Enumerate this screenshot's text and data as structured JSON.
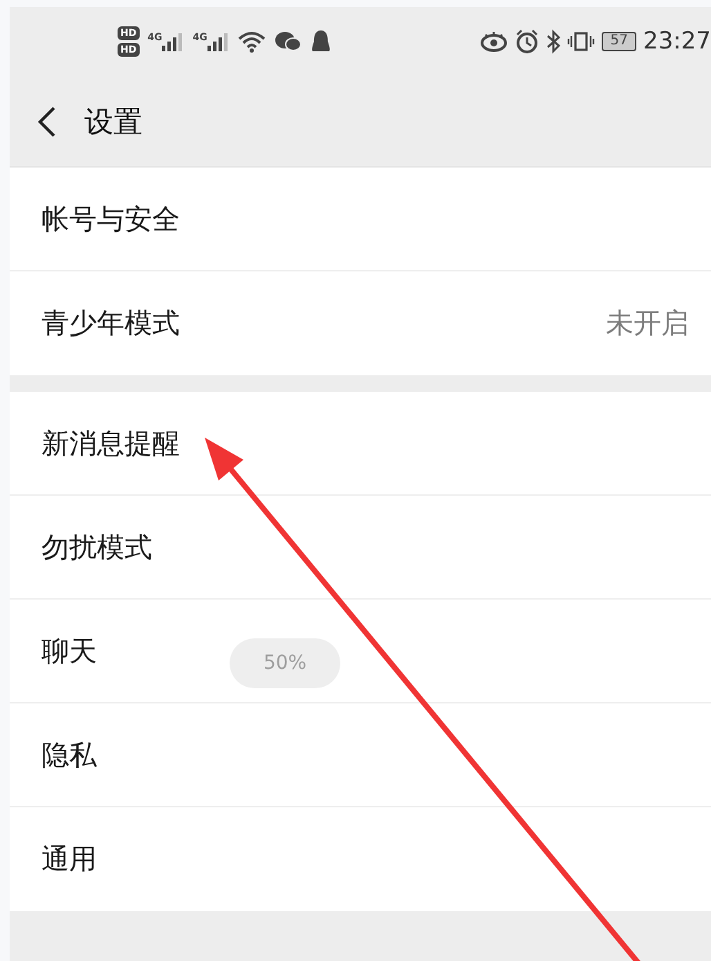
{
  "status_bar": {
    "sim_badges": [
      "HD",
      "HD"
    ],
    "network_labels": [
      "4G",
      "4G"
    ],
    "battery": "57",
    "time": "23:27"
  },
  "header": {
    "title": "设置"
  },
  "groups": [
    {
      "items": [
        {
          "label": "帐号与安全"
        },
        {
          "label": "青少年模式",
          "value": "未开启"
        }
      ]
    },
    {
      "items": [
        {
          "label": "新消息提醒"
        },
        {
          "label": "勿扰模式"
        },
        {
          "label": "聊天"
        },
        {
          "label": "隐私"
        },
        {
          "label": "通用"
        }
      ]
    }
  ],
  "toast": {
    "text": "50%"
  }
}
